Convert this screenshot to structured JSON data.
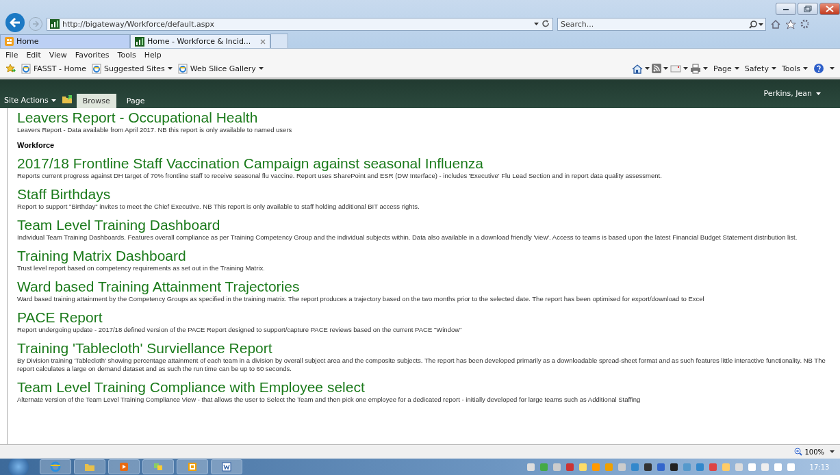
{
  "browser": {
    "address": "http://bigateway/Workforce/default.aspx",
    "search": {
      "placeholder": "Search..."
    },
    "tabs": [
      {
        "label": "Home",
        "selected": false
      },
      {
        "label": "Home - Workforce & Incid...",
        "selected": true
      }
    ],
    "menu": [
      "File",
      "Edit",
      "View",
      "Favorites",
      "Tools",
      "Help"
    ],
    "favorites": [
      {
        "label": "FASST - Home",
        "dropdown": false
      },
      {
        "label": "Suggested Sites",
        "dropdown": true
      },
      {
        "label": "Web Slice Gallery",
        "dropdown": true
      }
    ],
    "command_bar": [
      "Page",
      "Safety",
      "Tools"
    ]
  },
  "ribbon": {
    "site_actions": "Site Actions",
    "tabs": [
      {
        "label": "Browse",
        "selected": true
      },
      {
        "label": "Page",
        "selected": false
      }
    ],
    "user": "Perkins, Jean"
  },
  "content": {
    "items": [
      {
        "kind": "report",
        "title": "Leavers Report - Occupational Health",
        "description": "Leavers Report - Data available from April 2017. NB this report is only available to named users"
      },
      {
        "kind": "section",
        "title": "Workforce"
      },
      {
        "kind": "report",
        "title": "2017/18 Frontline Staff Vaccination Campaign against seasonal Influenza",
        "description": "Reports current progress against DH target of 70% frontline staff to receive seasonal flu vaccine. Report uses SharePoint and ESR (DW Interface) - includes 'Executive' Flu Lead Section and in report data quality assessment."
      },
      {
        "kind": "report",
        "title": "Staff Birthdays",
        "description": "Report to support \"Birthday\" invites to meet the Chief Executive. NB This report is only available to staff holding additional BIT access rights."
      },
      {
        "kind": "report",
        "title": "Team Level Training Dashboard",
        "description": "Individual Team Training Dashboards. Features overall compliance as per Training Competency Group and the individual subjects within. Data also available in a download friendly 'view'. Access to teams is based upon the latest Financial Budget Statement distribution list."
      },
      {
        "kind": "report",
        "title": "Training Matrix Dashboard",
        "description": "Trust level report based on competency requirements as set out in the Training Matrix."
      },
      {
        "kind": "report",
        "title": "Ward based Training Attainment Trajectories",
        "description": "Ward based training attainment by the Competency Groups as specified in the training matrix. The report produces a trajectory based on the two months prior to the selected date. The report has been optimised for export/download to Excel"
      },
      {
        "kind": "report",
        "title": "PACE Report",
        "description": "Report undergoing update - 2017/18 defined version of the PACE Report designed to support/capture PACE reviews based on the current PACE \"Window\""
      },
      {
        "kind": "report",
        "title": "Training 'Tablecloth' Surviellance Report",
        "description": "By Division training 'Tablecloth' showing percentage attainment of each team in a division by overall subject area and the composite subjects. The report has been developed primarily as a downloadable spread-sheet format and as such features little interactive functionality. NB The report calculates a large on demand dataset and as such the run time can be up to 60 seconds."
      },
      {
        "kind": "report",
        "title": "Team Level Training Compliance with Employee select",
        "description": "Alternate version of the Team Level Training Compliance View - that allows the user to Select the Team and then pick one employee for a dedicated report - initially developed for large teams such as Additional Staffing"
      }
    ]
  },
  "status_bar": {
    "zoom": "100%"
  },
  "taskbar": {
    "clock": "17:13"
  }
}
